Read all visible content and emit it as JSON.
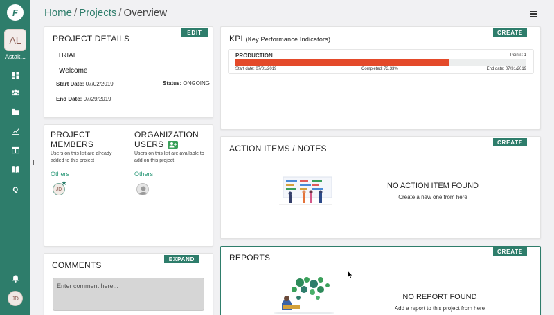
{
  "sidebar": {
    "logo_letter": "F",
    "avatar_initials": "AL",
    "org_name": "Astak...",
    "nav_icons": [
      "dashboard-icon",
      "users-icon",
      "folder-icon",
      "chart-icon",
      "board-icon",
      "book-icon",
      "quiz-icon"
    ],
    "bell_icon": "bell-icon",
    "user_initials": "JD"
  },
  "breadcrumb": {
    "home": "Home",
    "projects": "Projects",
    "current": "Overview",
    "separator": "/"
  },
  "project_details": {
    "title": "PROJECT DETAILS",
    "edit_label": "EDIT",
    "type": "TRIAL",
    "name": "Welcome",
    "start_label": "Start Date:",
    "start_value": "07/02/2019",
    "status_label": "Status:",
    "status_value": "ONGOING",
    "end_label": "End Date:",
    "end_value": "07/29/2019"
  },
  "members": {
    "title_line1": "PROJECT",
    "title_line2": "MEMBERS",
    "desc": "Users on this list are already added to this project",
    "group": "Others",
    "member_initials": "JD"
  },
  "org_users": {
    "title_line1": "ORGANIZATION",
    "title_line2": "USERS",
    "desc": "Users on this list are available to add on this project",
    "group": "Others"
  },
  "comments": {
    "title": "COMMENTS",
    "expand_label": "EXPAND",
    "placeholder": "Enter comment here..."
  },
  "kpi": {
    "title": "KPI",
    "subtitle": "(Key Performance Indicators)",
    "create_label": "CREATE",
    "item": {
      "name": "PRODUCTION",
      "points": "Points: 1",
      "progress_pct": 73.33,
      "start": "Start date: 07/01/2019",
      "completed": "Completed: 73.33%",
      "end": "End date: 07/31/2019"
    },
    "bar_color": "#e44a2a"
  },
  "actions": {
    "title": "ACTION ITEMS / NOTES",
    "create_label": "CREATE",
    "empty_title": "NO ACTION ITEM FOUND",
    "empty_sub": "Create a new one from here"
  },
  "reports": {
    "title": "REPORTS",
    "create_label": "CREATE",
    "empty_title": "NO REPORT FOUND",
    "empty_sub": "Add a report to this project from here"
  },
  "colors": {
    "brand": "#2e7d6b",
    "accent": "#e44a2a",
    "background": "#f1f1f3"
  }
}
